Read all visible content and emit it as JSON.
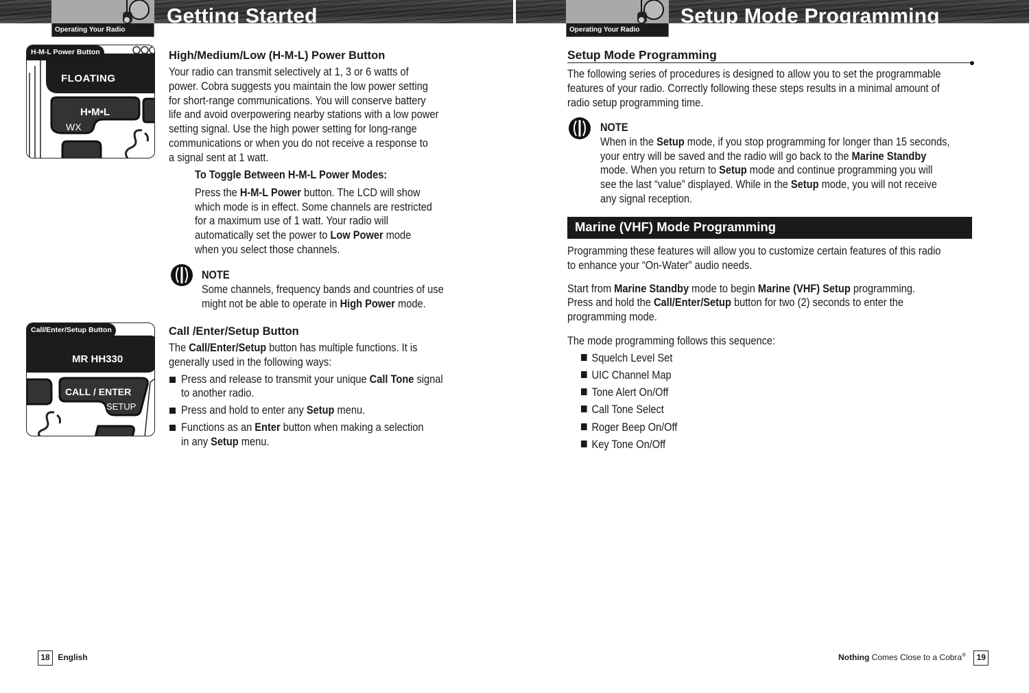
{
  "left_page": {
    "section_tab": "Operating Your Radio",
    "title": "Getting Started",
    "hml_image": {
      "label": "H-M-L Power Button",
      "brand_text": "FLOATING",
      "button_main": "H•M•L",
      "button_sub": "WX"
    },
    "call_image": {
      "label": "Call/Enter/Setup Button",
      "model_text": "MR HH330",
      "button_main": "CALL / ENTER",
      "button_sub": "SETUP"
    },
    "hml_section": {
      "heading": "High/Medium/Low (H-M-L) Power Button",
      "paragraph_lines": [
        "Your radio can transmit selectively at 1, 3 or 6 watts of",
        "power. Cobra suggests you maintain the low power setting",
        "for short-range communications. You will conserve battery",
        "life and avoid overpowering nearby stations with a low power",
        "setting signal. Use the high power setting for long-range",
        "communications or when you do not receive a response to",
        "a signal sent at 1 watt."
      ],
      "subheading": "To Toggle Between H-M-L Power Modes:",
      "toggle_lines": [
        {
          "pre": "Press the ",
          "bold": "H-M-L Power",
          "post": " button. The LCD will show"
        },
        {
          "pre": "which mode is in effect. Some channels are restricted",
          "bold": "",
          "post": ""
        },
        {
          "pre": "for a maximum use of 1 watt. Your radio will",
          "bold": "",
          "post": ""
        },
        {
          "pre": "automatically set the power to ",
          "bold": "Low Power",
          "post": " mode"
        },
        {
          "pre": "when you select those channels.",
          "bold": "",
          "post": ""
        }
      ],
      "note_title": "NOTE",
      "note_lines": [
        {
          "pre": "Some channels, frequency bands and countries of use",
          "bold": "",
          "post": ""
        },
        {
          "pre": "might not be able to operate in ",
          "bold": "High Power",
          "post": " mode."
        }
      ]
    },
    "call_section": {
      "heading": "Call /Enter/Setup Button",
      "intro_lines": [
        {
          "pre": "The ",
          "bold": "Call/Enter/Setup",
          "post": " button has multiple functions. It is"
        },
        {
          "pre": "generally used in the following ways:",
          "bold": "",
          "post": ""
        }
      ],
      "bullets": [
        {
          "lines": [
            {
              "pre": "Press and release to transmit your unique ",
              "bold": "Call Tone",
              "post": " signal"
            },
            {
              "pre": "to another radio.",
              "bold": "",
              "post": ""
            }
          ]
        },
        {
          "lines": [
            {
              "pre": "Press and hold to enter any ",
              "bold": "Setup",
              "post": " menu."
            }
          ]
        },
        {
          "lines": [
            {
              "pre": "Functions as an ",
              "bold": "Enter",
              "post": " button when making a selection"
            },
            {
              "pre": "in any ",
              "bold": "Setup",
              "post": " menu."
            }
          ]
        }
      ]
    },
    "footer": {
      "page_number": "18",
      "text": "English"
    }
  },
  "right_page": {
    "section_tab": "Operating Your Radio",
    "title": "Setup Mode Programming",
    "setup_section": {
      "heading": "Setup Mode Programming",
      "paragraph_lines": [
        "The following series of procedures is designed to allow you to set the programmable",
        "features of your radio. Correctly following these steps results in a minimal amount of",
        "radio setup programming time."
      ],
      "note_title": "NOTE",
      "note_lines": [
        {
          "pre": "When in the ",
          "bold": "Setup",
          "post": " mode, if you stop programming for longer than 15 seconds,"
        },
        {
          "pre": "your entry will be saved and the radio will go back to the ",
          "bold": "Marine Standby",
          "post": ""
        },
        {
          "pre": "mode. When you return to ",
          "bold": "Setup",
          "post": " mode and continue programming you will"
        },
        {
          "pre": "see the last “value” displayed. While in the ",
          "bold": "Setup",
          "post": " mode, you will not receive"
        },
        {
          "pre": "any signal reception.",
          "bold": "",
          "post": ""
        }
      ]
    },
    "marine_section": {
      "heading": "Marine (VHF) Mode Programming",
      "para1_lines": [
        "Programming these features will allow you to customize certain features of this radio",
        "to enhance your “On-Water” audio needs."
      ],
      "para2_lines": [
        {
          "segments": [
            [
              "Start from ",
              false
            ],
            [
              "Marine Standby",
              true
            ],
            [
              " mode to begin ",
              false
            ],
            [
              "Marine (VHF) Setup",
              true
            ],
            [
              " programming.",
              false
            ]
          ]
        },
        {
          "segments": [
            [
              "Press and hold the ",
              false
            ],
            [
              "Call/Enter/Setup",
              true
            ],
            [
              " button for two (2) seconds to enter the",
              false
            ]
          ]
        },
        {
          "segments": [
            [
              "programming mode.",
              false
            ]
          ]
        }
      ],
      "sequence_intro": "The mode programming follows this sequence:",
      "sequence": [
        "Squelch Level Set",
        "UIC Channel Map",
        "Tone Alert On/Off",
        "Call Tone Select",
        "Roger Beep On/Off",
        "Key Tone On/Off"
      ]
    },
    "footer": {
      "bold_text": "Nothing",
      "text": " Comes Close to a Cobra",
      "registered": "®",
      "page_number": "19"
    }
  }
}
